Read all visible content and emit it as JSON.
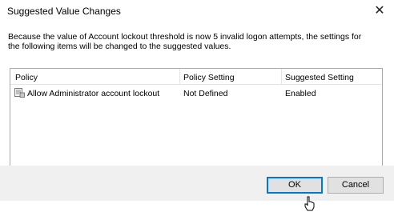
{
  "dialog": {
    "title": "Suggested Value Changes",
    "close_symbol": "✕",
    "message_line1": "Because the value of Account lockout threshold is now 5 invalid logon attempts, the settings for",
    "message_line2": "the following items will be changed to the suggested values."
  },
  "table": {
    "columns": [
      "Policy",
      "Policy Setting",
      "Suggested Setting"
    ],
    "rows": [
      {
        "icon": "policy-icon",
        "policy": "Allow Administrator account lockout",
        "policy_setting": "Not Defined",
        "suggested_setting": "Enabled"
      }
    ]
  },
  "scrollbar": {
    "left_arrow": "<",
    "right_arrow": ">"
  },
  "buttons": {
    "ok": "OK",
    "cancel": "Cancel"
  },
  "colors": {
    "ok_border": "#0078d7",
    "footer_bg": "#f0f0f0"
  }
}
